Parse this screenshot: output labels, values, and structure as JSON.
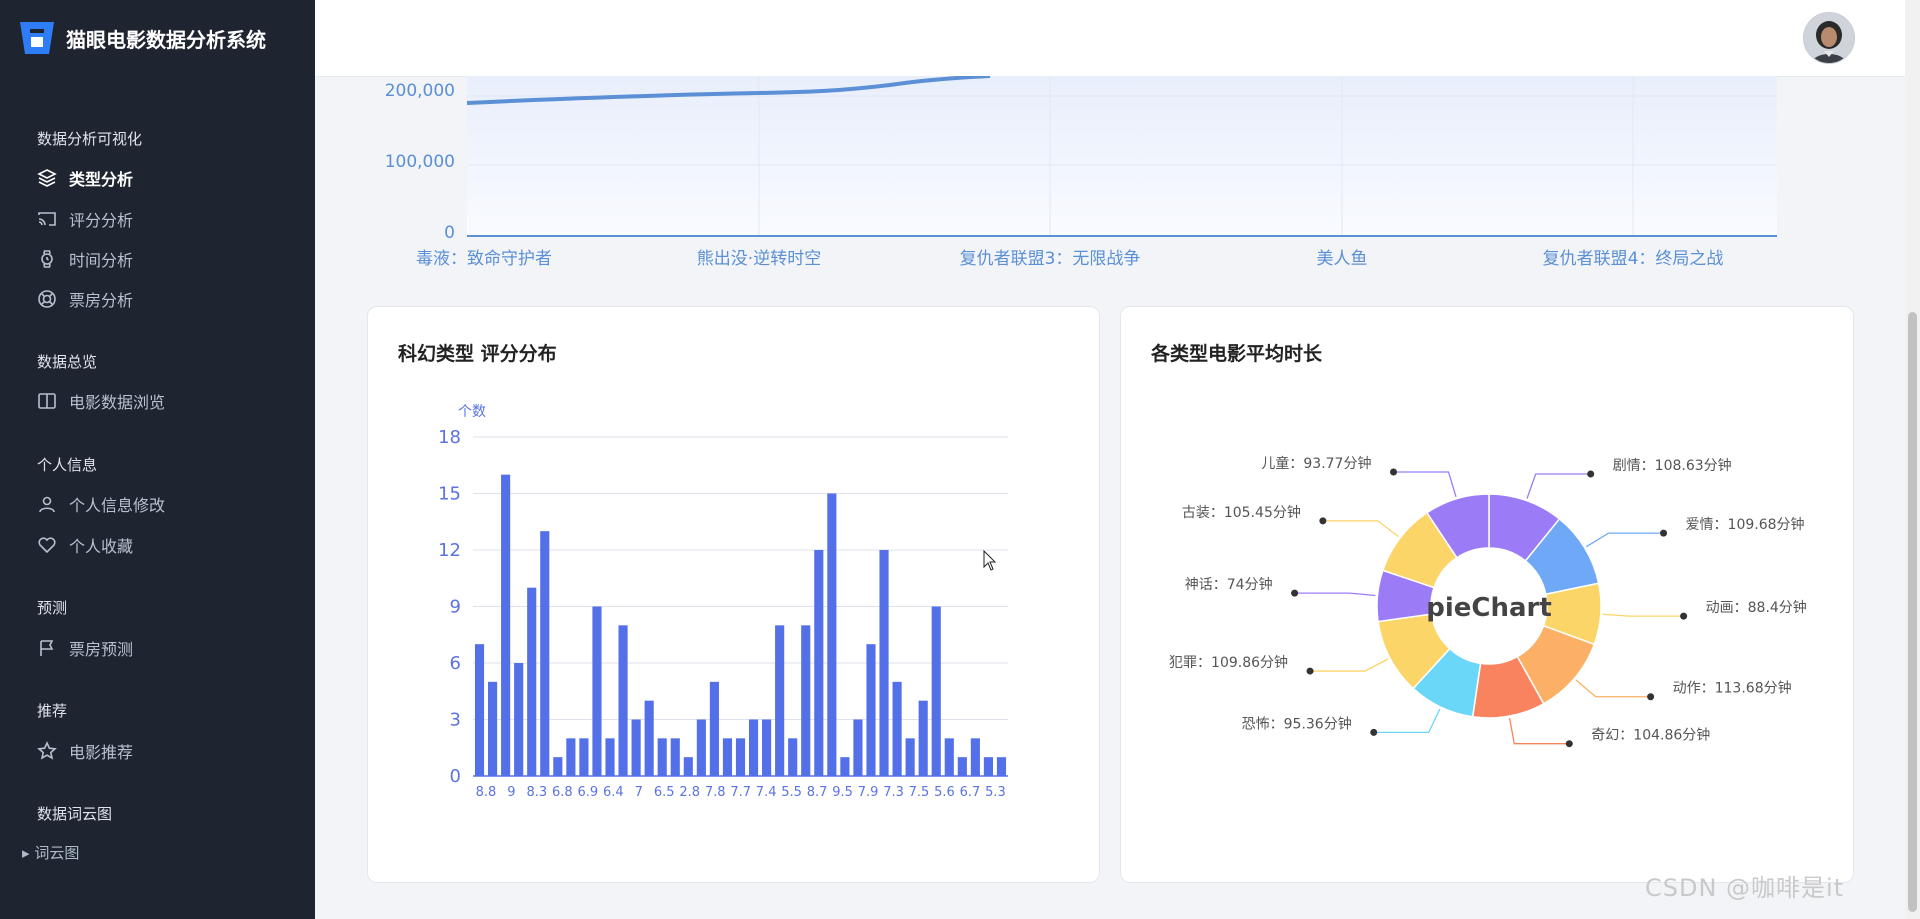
{
  "app": {
    "title": "猫眼电影数据分析系统"
  },
  "sidebar": {
    "sections": [
      {
        "title": "数据分析可视化",
        "items": [
          {
            "label": "类型分析",
            "icon": "layers-icon",
            "active": true
          },
          {
            "label": "评分分析",
            "icon": "cast-icon"
          },
          {
            "label": "时间分析",
            "icon": "watch-icon"
          },
          {
            "label": "票房分析",
            "icon": "lifebuoy-icon"
          }
        ]
      },
      {
        "title": "数据总览",
        "items": [
          {
            "label": "电影数据浏览",
            "icon": "columns-icon"
          }
        ]
      },
      {
        "title": "个人信息",
        "items": [
          {
            "label": "个人信息修改",
            "icon": "user-icon"
          },
          {
            "label": "个人收藏",
            "icon": "heart-icon"
          }
        ]
      },
      {
        "title": "预测",
        "items": [
          {
            "label": "票房预测",
            "icon": "flag-icon"
          }
        ]
      },
      {
        "title": "推荐",
        "items": [
          {
            "label": "电影推荐",
            "icon": "star-icon"
          }
        ]
      },
      {
        "title": "数据词云图",
        "items": []
      }
    ],
    "partial_item": "词云图"
  },
  "chart_data": [
    {
      "type": "area",
      "yticks": [
        "200,000",
        "100,000",
        "0"
      ],
      "categories": [
        "毒液：致命守护者",
        "熊出没·逆转时空",
        "复仇者联盟3：无限战争",
        "美人鱼",
        "复仇者联盟4：终局之战"
      ]
    },
    {
      "type": "bar",
      "title": "科幻类型 评分分布",
      "ylabel": "个数",
      "ylim": [
        0,
        18
      ],
      "yticks": [
        0,
        3,
        6,
        9,
        12,
        15,
        18
      ],
      "xtick_labels": [
        "8.8",
        "9",
        "8.3",
        "6.8",
        "6.9",
        "6.4",
        "7",
        "6.5",
        "2.8",
        "7.8",
        "7.7",
        "7.4",
        "5.5",
        "8.7",
        "9.5",
        "7.9",
        "7.3",
        "7.5",
        "5.6",
        "6.7",
        "5.3"
      ],
      "values": [
        7,
        5,
        16,
        6,
        10,
        13,
        1,
        2,
        2,
        9,
        2,
        8,
        3,
        4,
        2,
        2,
        1,
        3,
        5,
        2,
        2,
        3,
        3,
        8,
        2,
        8,
        12,
        15,
        1,
        3,
        7,
        12,
        5,
        2,
        4,
        9,
        2,
        1,
        2,
        1,
        1
      ],
      "color": "#5470e8"
    },
    {
      "type": "pie",
      "title": "各类型电影平均时长",
      "center_text": "pieChart",
      "slices": [
        {
          "label": "剧情：108.63分钟",
          "value": 108.63,
          "color": "#9b7cf6"
        },
        {
          "label": "爱情：109.68分钟",
          "value": 109.68,
          "color": "#6fa8f7"
        },
        {
          "label": "动画：88.4分钟",
          "value": 88.4,
          "color": "#fcd568"
        },
        {
          "label": "动作：113.68分钟",
          "value": 113.68,
          "color": "#fbb066"
        },
        {
          "label": "奇幻：104.86分钟",
          "value": 104.86,
          "color": "#f8835e"
        },
        {
          "label": "恐怖：95.36分钟",
          "value": 95.36,
          "color": "#6ad7f8"
        },
        {
          "label": "犯罪：109.86分钟",
          "value": 109.86,
          "color": "#fcd568"
        },
        {
          "label": "神话：74分钟",
          "value": 74,
          "color": "#9b7cf6"
        },
        {
          "label": "古装：105.45分钟",
          "value": 105.45,
          "color": "#fcd568"
        },
        {
          "label": "儿童：93.77分钟",
          "value": 93.77,
          "color": "#9b7cf6"
        }
      ]
    }
  ],
  "watermark": "CSDN @咖啡是it"
}
